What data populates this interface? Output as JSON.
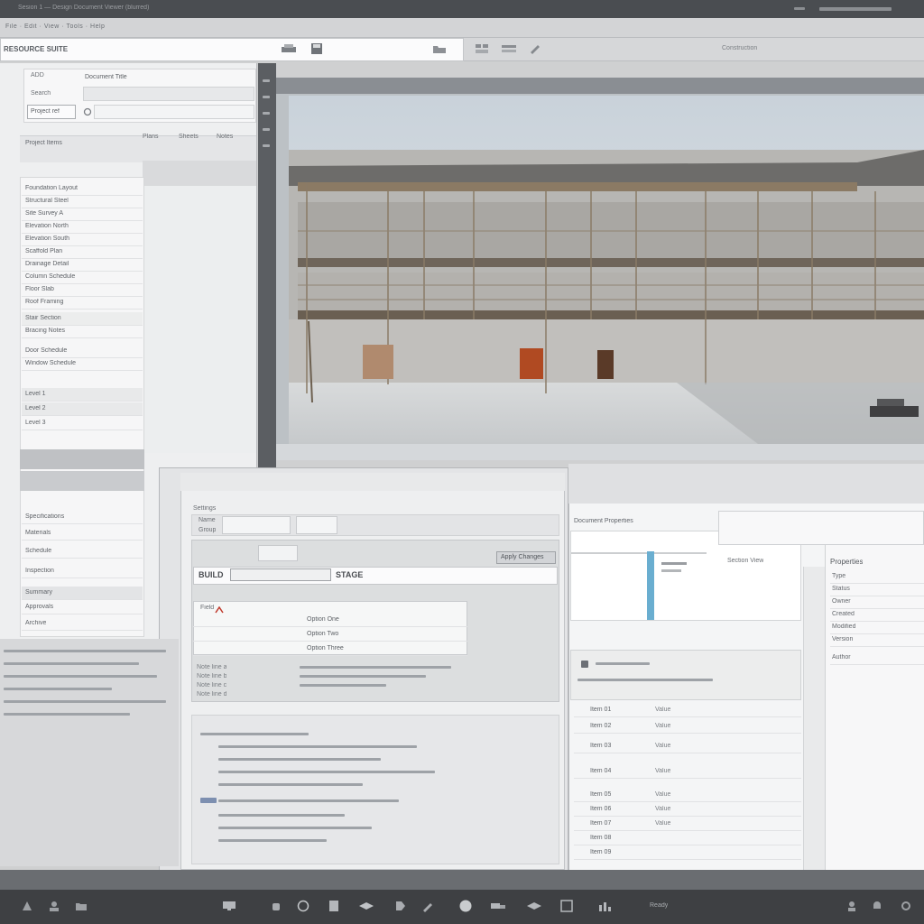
{
  "topbar": {
    "title_blur": "Sesion 1 — Design Document Viewer (blurred)",
    "menu": [
      "File",
      "Edit",
      "View",
      "Tools",
      "Help"
    ],
    "right_label": "Construction"
  },
  "address": {
    "value": "RESOURCE SUITE"
  },
  "left_panel": {
    "header_a": "ADD",
    "header_b": "Document Title",
    "field_label": "Search",
    "field_value": "Project ref",
    "section_a": "Project Items",
    "tabs": [
      "Plans",
      "Sheets",
      "Notes"
    ],
    "list_rows": [
      "Foundation Layout",
      "Structural Steel",
      "Site Survey A",
      "Elevation North",
      "Elevation South",
      "Scaffold Plan",
      "Drainage Detail",
      "Column Schedule",
      "Floor Slab",
      "Roof Framing",
      "Stair Section",
      "Bracing Notes",
      "Door Schedule",
      "Window Schedule",
      "Level 1",
      "Level 2",
      "Level 3"
    ],
    "lower_rows": [
      "Specifications",
      "Materials",
      "Schedule",
      "Inspection",
      "Summary",
      "Approvals",
      "Archive"
    ]
  },
  "viewer": {
    "image_alt": "Construction site rendering with scaffolding"
  },
  "dialog": {
    "title": "Settings",
    "field1_label": "Name",
    "field2_label": "Group",
    "button_label": "Apply Changes",
    "table_header": "Field",
    "tag1": "BUILD",
    "tag2": "STAGE",
    "rows": [
      "Option One",
      "Option Two",
      "Option Three"
    ],
    "notes": [
      "Note line a",
      "Note line b",
      "Note line c",
      "Note line d"
    ]
  },
  "right_panel": {
    "title": "Document Properties",
    "chart_caption": "Section View",
    "side_title": "Properties",
    "side_rows": [
      "Type",
      "Status",
      "Owner",
      "Created",
      "Modified",
      "Version",
      "Author"
    ],
    "list_rows": [
      "Item 01",
      "Item 02",
      "Item 03",
      "Item 04",
      "Item 05",
      "Item 06",
      "Item 07",
      "Item 08",
      "Item 09"
    ],
    "value_rows": [
      "Value",
      "Value",
      "Value",
      "Value",
      "Value",
      "Value",
      "Value"
    ]
  },
  "taskbar": {
    "status_text": "Ready"
  },
  "colors": {
    "accent": "#6aaed0",
    "door_red": "#b04a22",
    "panel": "#f2f3f4",
    "chrome_dark": "#5b5e62"
  }
}
